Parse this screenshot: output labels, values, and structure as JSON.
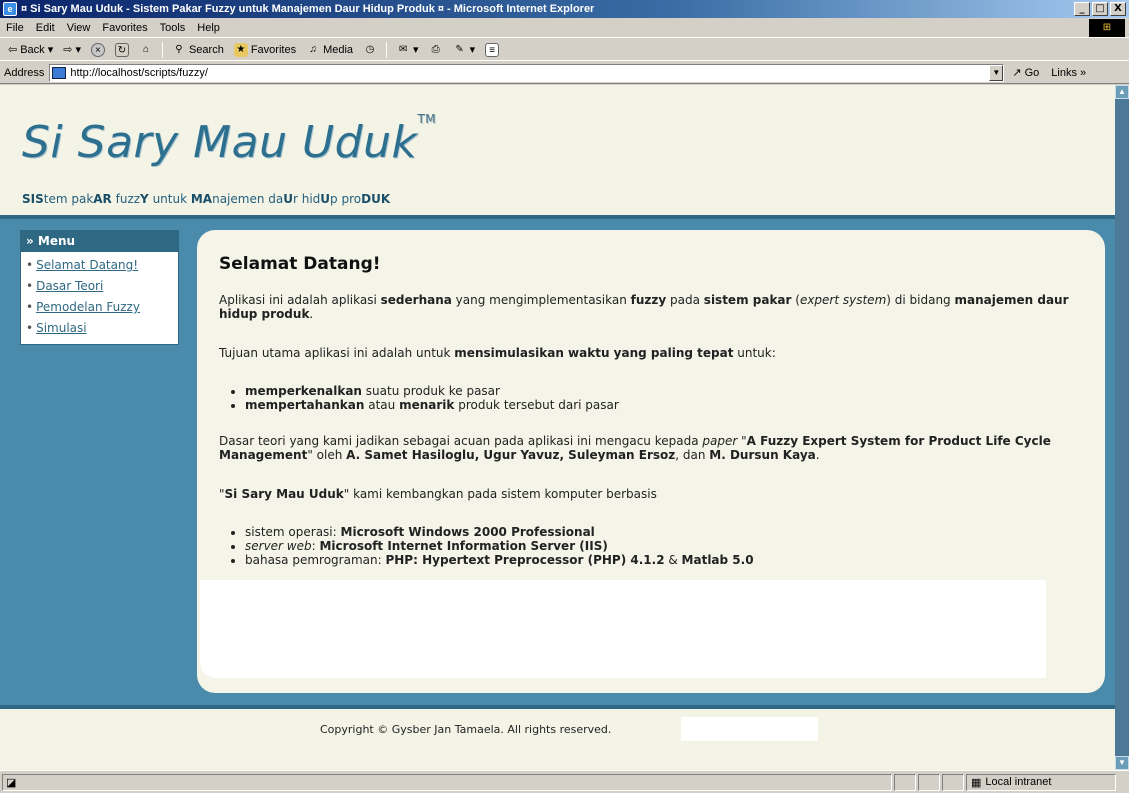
{
  "window": {
    "title": "¤ Si Sary Mau Uduk - Sistem Pakar Fuzzy untuk Manajemen Daur Hidup Produk ¤ - Microsoft Internet Explorer",
    "min": "_",
    "max": "□",
    "close": "X"
  },
  "menubar": [
    "File",
    "Edit",
    "View",
    "Favorites",
    "Tools",
    "Help"
  ],
  "toolbar": {
    "back": "Back",
    "search": "Search",
    "favorites": "Favorites",
    "media": "Media"
  },
  "address": {
    "label": "Address",
    "value": "http://localhost/scripts/fuzzy/",
    "go": "Go",
    "links": "Links »"
  },
  "header": {
    "logo": "Si Sary Mau Uduk",
    "tm": "TM",
    "tagline": [
      {
        "t": "SIS",
        "b": true
      },
      {
        "t": "tem pak",
        "b": false
      },
      {
        "t": "AR",
        "b": true
      },
      {
        "t": " fuzz",
        "b": false
      },
      {
        "t": "Y",
        "b": true
      },
      {
        "t": " untuk ",
        "b": false
      },
      {
        "t": "MA",
        "b": true
      },
      {
        "t": "najemen da",
        "b": false
      },
      {
        "t": "U",
        "b": true
      },
      {
        "t": "r hid",
        "b": false
      },
      {
        "t": "U",
        "b": true
      },
      {
        "t": "p pro",
        "b": false
      },
      {
        "t": "DUK",
        "b": true
      }
    ]
  },
  "menu": {
    "title": "» Menu",
    "items": [
      "Selamat Datang!",
      "Dasar Teori",
      "Pemodelan Fuzzy",
      "Simulasi"
    ]
  },
  "content": {
    "heading": "Selamat Datang!",
    "intro_a": "Aplikasi ini adalah aplikasi ",
    "intro_b": "sederhana",
    "intro_c": " yang mengimplementasikan ",
    "intro_d": "fuzzy",
    "intro_e": " pada ",
    "intro_f": "sistem pakar",
    "intro_g": " (",
    "intro_h": "expert system",
    "intro_i": ") di bidang ",
    "intro_j": "manajemen daur hidup produk",
    "intro_k": ".",
    "goal_a": "Tujuan utama aplikasi ini adalah untuk ",
    "goal_b": "mensimulasikan waktu yang paling tepat",
    "goal_c": " untuk:",
    "b1_a": "memperkenalkan",
    "b1_b": " suatu produk ke pasar",
    "b2_a": "mempertahankan",
    "b2_b": " atau ",
    "b2_c": "menarik",
    "b2_d": " produk tersebut dari pasar",
    "theory_a": "Dasar teori yang kami jadikan sebagai acuan pada aplikasi ini mengacu kepada ",
    "theory_b": "paper",
    "theory_c": " \"",
    "theory_d": "A Fuzzy Expert System for Product Life Cycle Management",
    "theory_e": "\" oleh ",
    "theory_f": "A. Samet Hasiloglu, Ugur Yavuz, Suleyman Ersoz",
    "theory_g": ", dan ",
    "theory_h": "M. Dursun Kaya",
    "theory_i": ".",
    "dev_a": "\"",
    "dev_b": "Si Sary Mau Uduk",
    "dev_c": "\" kami kembangkan pada sistem komputer berbasis",
    "s1_a": "sistem operasi: ",
    "s1_b": "Microsoft Windows 2000 Professional",
    "s2_a": "server web",
    "s2_b": ": ",
    "s2_c": "Microsoft Internet Information Server (IIS)",
    "s3_a": "bahasa pemrograman: ",
    "s3_b": "PHP: Hypertext Preprocessor (PHP) 4.1.2",
    "s3_c": " & ",
    "s3_d": "Matlab 5.0"
  },
  "footer": {
    "copyright": "Copyright © Gysber Jan Tamaela. All rights reserved."
  },
  "status": {
    "zone": "Local intranet"
  }
}
